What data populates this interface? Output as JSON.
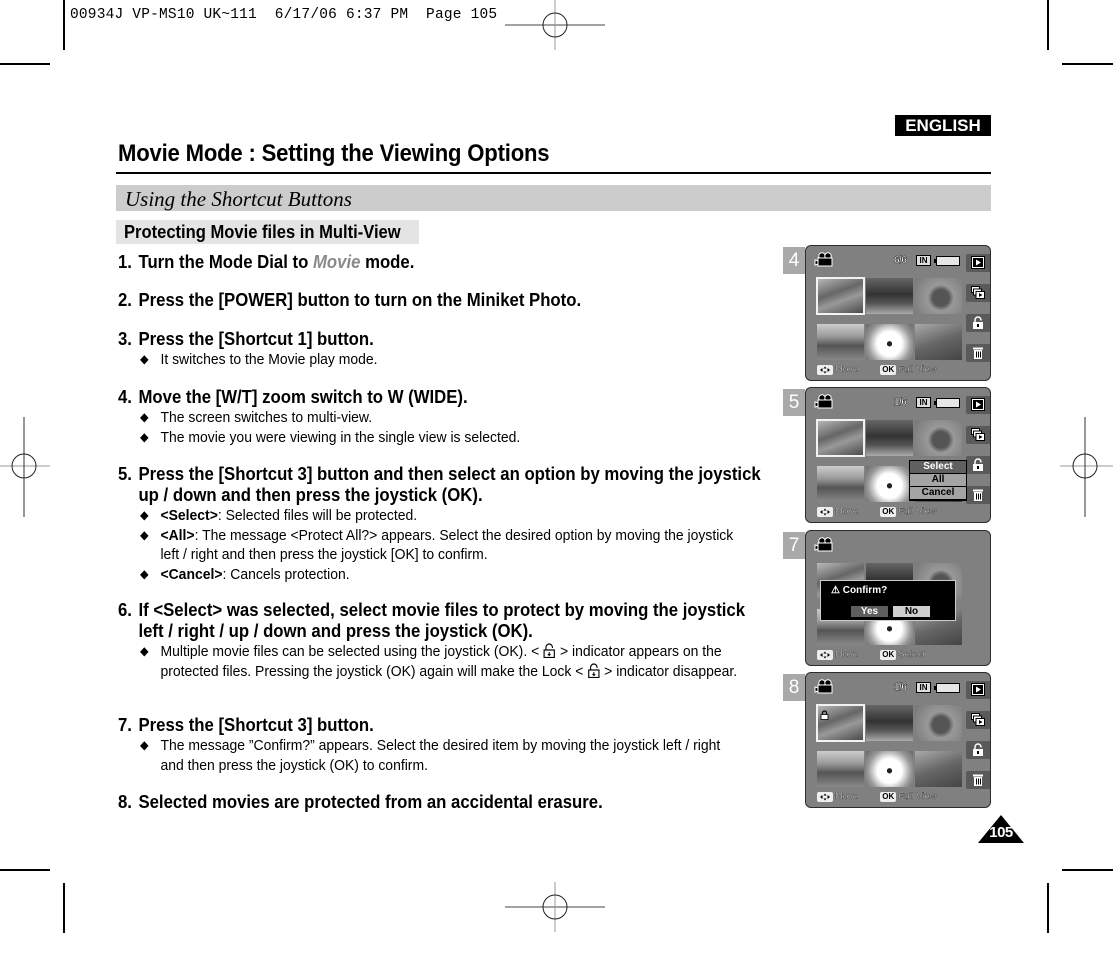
{
  "print_slug": "00934J VP-MS10 UK~111  6/17/06 6:37 PM  Page 105",
  "language_badge": "ENGLISH",
  "page_title": "Movie Mode : Setting the Viewing Options",
  "section_title": "Using the Shortcut Buttons",
  "subsection_title": "Protecting Movie files in Multi-View",
  "steps": [
    {
      "num": "1.",
      "pre": "Turn the Mode Dial to ",
      "highlight": "Movie",
      "post": " mode."
    },
    {
      "num": "2.",
      "text": "Press the [POWER] button to turn on the Miniket Photo."
    },
    {
      "num": "3.",
      "text": "Press the [Shortcut 1] button.",
      "bullets": [
        "It switches to the Movie play mode."
      ]
    },
    {
      "num": "4.",
      "text": "Move the [W/T] zoom switch to W (WIDE).",
      "bullets": [
        "The screen switches to multi-view.",
        "The movie you were viewing in the single view is selected."
      ]
    },
    {
      "num": "5.",
      "text": "Press the [Shortcut 3] button and then select an option by moving the joystick up / down and then press the joystick (OK).",
      "bullets": [
        {
          "term": "<Select>",
          "desc": ": Selected files will be protected."
        },
        {
          "term": "<All>",
          "desc": ": The message <Protect All?> appears. Select the desired option by moving the joystick left / right and then press the joystick [OK] to confirm."
        },
        {
          "term": "<Cancel>",
          "desc": ": Cancels protection."
        }
      ]
    },
    {
      "num": "6.",
      "text": "If <Select> was selected, select movie files to protect by moving the joystick left / right / up / down and press the joystick (OK).",
      "bullets": [
        {
          "p1": "Multiple movie files can be selected using the joystick (OK). < ",
          "p2": " > indicator appears on the protected files. Pressing the joystick (OK) again will make the Lock < ",
          "p3": " > indicator disappear."
        }
      ]
    },
    {
      "num": "7.",
      "text": "Press the [Shortcut 3] button.",
      "bullets": [
        "The message ”Confirm?” appears. Select the desired item by moving the joystick left / right  and then press the joystick (OK) to confirm."
      ]
    },
    {
      "num": "8.",
      "text": "Selected movies are protected from an accidental erasure."
    }
  ],
  "screens": [
    {
      "label": "4",
      "counter": "6/6",
      "storage": "IN",
      "footer_move": "Move",
      "footer_ok_key": "OK",
      "footer_ok": "Full View"
    },
    {
      "label": "5",
      "counter": "1/6",
      "storage": "IN",
      "footer_move": "Move",
      "footer_ok_key": "OK",
      "footer_ok": "Full View",
      "menu": [
        "Select",
        "All",
        "Cancel"
      ],
      "menu_active": "Select"
    },
    {
      "label": "7",
      "footer_move": "Move",
      "footer_ok_key": "OK",
      "footer_ok": "Select",
      "dialog": {
        "title": "Confirm?",
        "yes": "Yes",
        "no": "No",
        "focused": "Yes"
      }
    },
    {
      "label": "8",
      "counter": "1/6",
      "storage": "IN",
      "footer_move": "Move",
      "footer_ok_key": "OK",
      "footer_ok": "Full View"
    }
  ],
  "page_number": "105"
}
